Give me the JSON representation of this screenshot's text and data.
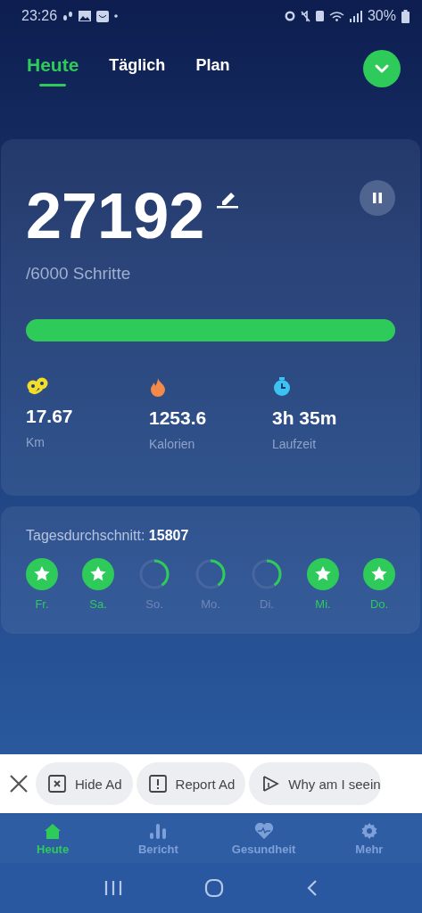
{
  "status_bar": {
    "time": "23:26",
    "battery": "30%"
  },
  "tabs": [
    {
      "label": "Heute",
      "selected": true
    },
    {
      "label": "Täglich",
      "selected": false
    },
    {
      "label": "Plan",
      "selected": false
    }
  ],
  "steps": {
    "count": "27192",
    "goal": "/6000 Schritte",
    "level": 1
  },
  "stats": [
    {
      "kind": "distance",
      "value": "17.67",
      "label": "Km"
    },
    {
      "kind": "calories",
      "value": "1253.6",
      "label": "Kalorien"
    },
    {
      "kind": "time",
      "value": "3h 35m",
      "label": "Laufzeit"
    }
  ],
  "average": {
    "text": "Tagesdurchschnitt: **15807**"
  },
  "days": [
    {
      "label": "Fr.",
      "kind": "star"
    },
    {
      "label": "Sa.",
      "kind": "star"
    },
    {
      "label": "So.",
      "kind": "ring"
    },
    {
      "label": "Mo.",
      "kind": "ring"
    },
    {
      "label": "Di.",
      "kind": "ring"
    },
    {
      "label": "Mi.",
      "kind": "star"
    },
    {
      "label": "Do.",
      "kind": "star"
    }
  ],
  "ad_bar": {
    "actions": [
      {
        "kind": "hide",
        "label": "Hide Ad"
      },
      {
        "kind": "report",
        "label": "Report Ad"
      },
      {
        "kind": "why",
        "label": "Why am I seein"
      }
    ]
  },
  "bottom_nav": [
    {
      "kind": "home",
      "label": "Heute",
      "selected": true
    },
    {
      "kind": "report",
      "label": "Bericht",
      "selected": false
    },
    {
      "kind": "health",
      "label": "Gesundheit",
      "selected": false
    },
    {
      "kind": "more",
      "label": "Mehr",
      "selected": false
    }
  ]
}
